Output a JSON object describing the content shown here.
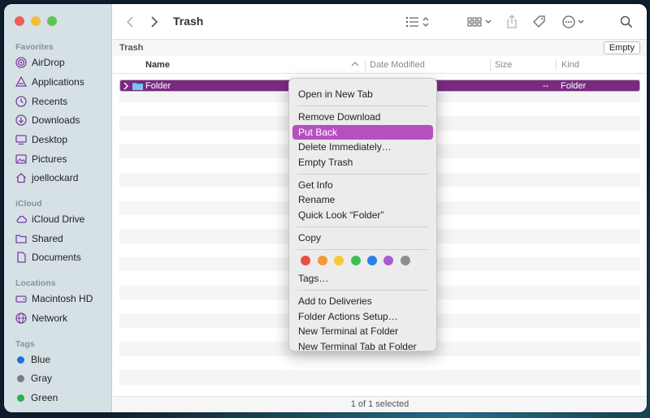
{
  "window": {
    "title": "Trash"
  },
  "sidebar": {
    "favorites_title": "Favorites",
    "favorites": [
      {
        "label": "AirDrop",
        "icon": "airdrop-icon"
      },
      {
        "label": "Applications",
        "icon": "applications-icon"
      },
      {
        "label": "Recents",
        "icon": "clock-icon"
      },
      {
        "label": "Downloads",
        "icon": "download-icon"
      },
      {
        "label": "Desktop",
        "icon": "desktop-icon"
      },
      {
        "label": "Pictures",
        "icon": "pictures-icon"
      },
      {
        "label": "joellockard",
        "icon": "home-icon"
      }
    ],
    "icloud_title": "iCloud",
    "icloud": [
      {
        "label": "iCloud Drive",
        "icon": "cloud-icon"
      },
      {
        "label": "Shared",
        "icon": "shared-folder-icon"
      },
      {
        "label": "Documents",
        "icon": "document-icon"
      }
    ],
    "locations_title": "Locations",
    "locations": [
      {
        "label": "Macintosh HD",
        "icon": "disk-icon"
      },
      {
        "label": "Network",
        "icon": "globe-icon"
      }
    ],
    "tags_title": "Tags",
    "tags": [
      {
        "label": "Blue",
        "color": "#1f6fe0"
      },
      {
        "label": "Gray",
        "color": "#7c7c7c"
      },
      {
        "label": "Green",
        "color": "#2ab24a"
      }
    ]
  },
  "pathbar": {
    "label": "Trash",
    "empty_button": "Empty"
  },
  "columns": {
    "name": "Name",
    "date": "Date Modified",
    "size": "Size",
    "kind": "Kind"
  },
  "file": {
    "name": "Folder",
    "size": "--",
    "kind": "Folder"
  },
  "status": {
    "text": "1 of 1 selected"
  },
  "menu": {
    "items": [
      "Open in New Tab",
      "Remove Download",
      "Put Back",
      "Delete Immediately…",
      "Empty Trash",
      "Get Info",
      "Rename",
      "Quick Look “Folder”",
      "Copy",
      "Tags…",
      "Add to Deliveries",
      "Folder Actions Setup…",
      "New Terminal at Folder",
      "New Terminal Tab at Folder"
    ],
    "highlighted": "Put Back",
    "tag_colors": [
      "#ea4b44",
      "#f19a37",
      "#f5c935",
      "#3dbf55",
      "#2e7fe6",
      "#a65bd0",
      "#8e8e8e"
    ]
  },
  "colors": {
    "accent": "#b84fc1",
    "selection": "#7a2a80",
    "sidebar_icon": "#7b3ea0"
  }
}
